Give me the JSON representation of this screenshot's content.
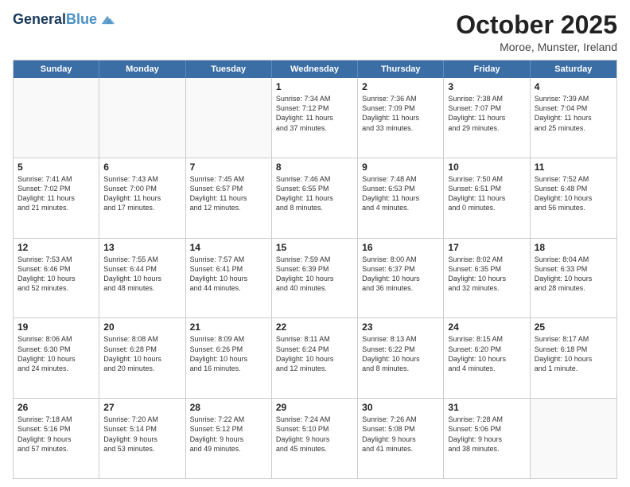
{
  "logo": {
    "line1": "General",
    "line2": "Blue"
  },
  "header": {
    "month": "October 2025",
    "location": "Moroe, Munster, Ireland"
  },
  "days": [
    "Sunday",
    "Monday",
    "Tuesday",
    "Wednesday",
    "Thursday",
    "Friday",
    "Saturday"
  ],
  "weeks": [
    [
      {
        "day": "",
        "info": ""
      },
      {
        "day": "",
        "info": ""
      },
      {
        "day": "",
        "info": ""
      },
      {
        "day": "1",
        "info": "Sunrise: 7:34 AM\nSunset: 7:12 PM\nDaylight: 11 hours\nand 37 minutes."
      },
      {
        "day": "2",
        "info": "Sunrise: 7:36 AM\nSunset: 7:09 PM\nDaylight: 11 hours\nand 33 minutes."
      },
      {
        "day": "3",
        "info": "Sunrise: 7:38 AM\nSunset: 7:07 PM\nDaylight: 11 hours\nand 29 minutes."
      },
      {
        "day": "4",
        "info": "Sunrise: 7:39 AM\nSunset: 7:04 PM\nDaylight: 11 hours\nand 25 minutes."
      }
    ],
    [
      {
        "day": "5",
        "info": "Sunrise: 7:41 AM\nSunset: 7:02 PM\nDaylight: 11 hours\nand 21 minutes."
      },
      {
        "day": "6",
        "info": "Sunrise: 7:43 AM\nSunset: 7:00 PM\nDaylight: 11 hours\nand 17 minutes."
      },
      {
        "day": "7",
        "info": "Sunrise: 7:45 AM\nSunset: 6:57 PM\nDaylight: 11 hours\nand 12 minutes."
      },
      {
        "day": "8",
        "info": "Sunrise: 7:46 AM\nSunset: 6:55 PM\nDaylight: 11 hours\nand 8 minutes."
      },
      {
        "day": "9",
        "info": "Sunrise: 7:48 AM\nSunset: 6:53 PM\nDaylight: 11 hours\nand 4 minutes."
      },
      {
        "day": "10",
        "info": "Sunrise: 7:50 AM\nSunset: 6:51 PM\nDaylight: 11 hours\nand 0 minutes."
      },
      {
        "day": "11",
        "info": "Sunrise: 7:52 AM\nSunset: 6:48 PM\nDaylight: 10 hours\nand 56 minutes."
      }
    ],
    [
      {
        "day": "12",
        "info": "Sunrise: 7:53 AM\nSunset: 6:46 PM\nDaylight: 10 hours\nand 52 minutes."
      },
      {
        "day": "13",
        "info": "Sunrise: 7:55 AM\nSunset: 6:44 PM\nDaylight: 10 hours\nand 48 minutes."
      },
      {
        "day": "14",
        "info": "Sunrise: 7:57 AM\nSunset: 6:41 PM\nDaylight: 10 hours\nand 44 minutes."
      },
      {
        "day": "15",
        "info": "Sunrise: 7:59 AM\nSunset: 6:39 PM\nDaylight: 10 hours\nand 40 minutes."
      },
      {
        "day": "16",
        "info": "Sunrise: 8:00 AM\nSunset: 6:37 PM\nDaylight: 10 hours\nand 36 minutes."
      },
      {
        "day": "17",
        "info": "Sunrise: 8:02 AM\nSunset: 6:35 PM\nDaylight: 10 hours\nand 32 minutes."
      },
      {
        "day": "18",
        "info": "Sunrise: 8:04 AM\nSunset: 6:33 PM\nDaylight: 10 hours\nand 28 minutes."
      }
    ],
    [
      {
        "day": "19",
        "info": "Sunrise: 8:06 AM\nSunset: 6:30 PM\nDaylight: 10 hours\nand 24 minutes."
      },
      {
        "day": "20",
        "info": "Sunrise: 8:08 AM\nSunset: 6:28 PM\nDaylight: 10 hours\nand 20 minutes."
      },
      {
        "day": "21",
        "info": "Sunrise: 8:09 AM\nSunset: 6:26 PM\nDaylight: 10 hours\nand 16 minutes."
      },
      {
        "day": "22",
        "info": "Sunrise: 8:11 AM\nSunset: 6:24 PM\nDaylight: 10 hours\nand 12 minutes."
      },
      {
        "day": "23",
        "info": "Sunrise: 8:13 AM\nSunset: 6:22 PM\nDaylight: 10 hours\nand 8 minutes."
      },
      {
        "day": "24",
        "info": "Sunrise: 8:15 AM\nSunset: 6:20 PM\nDaylight: 10 hours\nand 4 minutes."
      },
      {
        "day": "25",
        "info": "Sunrise: 8:17 AM\nSunset: 6:18 PM\nDaylight: 10 hours\nand 1 minute."
      }
    ],
    [
      {
        "day": "26",
        "info": "Sunrise: 7:18 AM\nSunset: 5:16 PM\nDaylight: 9 hours\nand 57 minutes."
      },
      {
        "day": "27",
        "info": "Sunrise: 7:20 AM\nSunset: 5:14 PM\nDaylight: 9 hours\nand 53 minutes."
      },
      {
        "day": "28",
        "info": "Sunrise: 7:22 AM\nSunset: 5:12 PM\nDaylight: 9 hours\nand 49 minutes."
      },
      {
        "day": "29",
        "info": "Sunrise: 7:24 AM\nSunset: 5:10 PM\nDaylight: 9 hours\nand 45 minutes."
      },
      {
        "day": "30",
        "info": "Sunrise: 7:26 AM\nSunset: 5:08 PM\nDaylight: 9 hours\nand 41 minutes."
      },
      {
        "day": "31",
        "info": "Sunrise: 7:28 AM\nSunset: 5:06 PM\nDaylight: 9 hours\nand 38 minutes."
      },
      {
        "day": "",
        "info": ""
      }
    ]
  ]
}
